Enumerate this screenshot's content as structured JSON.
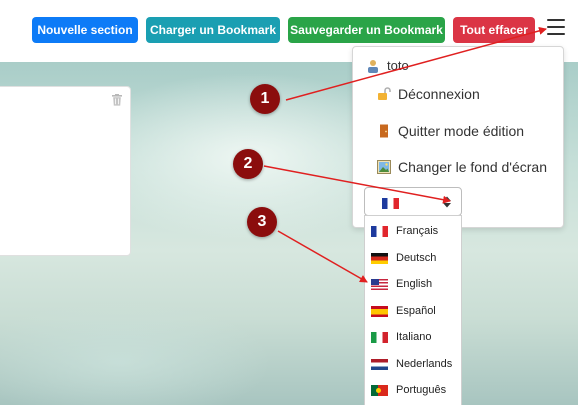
{
  "toolbar": {
    "new_section": "Nouvelle section",
    "load_bookmark": "Charger un Bookmark",
    "save_bookmark": "Sauvegarder un Bookmark",
    "clear_all": "Tout effacer"
  },
  "menu": {
    "username": "toto",
    "logout": "Déconnexion",
    "quit_edit": "Quitter mode édition",
    "change_background": "Changer le fond d'écran"
  },
  "language_select": {
    "selected_flag": "flag-fr-icon"
  },
  "languages": [
    {
      "label": "Français",
      "flag": "flag-fr-icon"
    },
    {
      "label": "Deutsch",
      "flag": "flag-de-icon"
    },
    {
      "label": "English",
      "flag": "flag-us-icon"
    },
    {
      "label": "Español",
      "flag": "flag-es-icon"
    },
    {
      "label": "Italiano",
      "flag": "flag-it-icon"
    },
    {
      "label": "Nederlands",
      "flag": "flag-nl-icon"
    },
    {
      "label": "Português",
      "flag": "flag-pt-icon"
    }
  ],
  "callouts": [
    "1",
    "2",
    "3"
  ],
  "colors": {
    "new_section": "#0d7bf7",
    "load_bookmark": "#1a9fb2",
    "save_bookmark": "#2aa448",
    "clear_all": "#db3545",
    "callout": "#8b0d0d",
    "arrow": "#e02020"
  }
}
